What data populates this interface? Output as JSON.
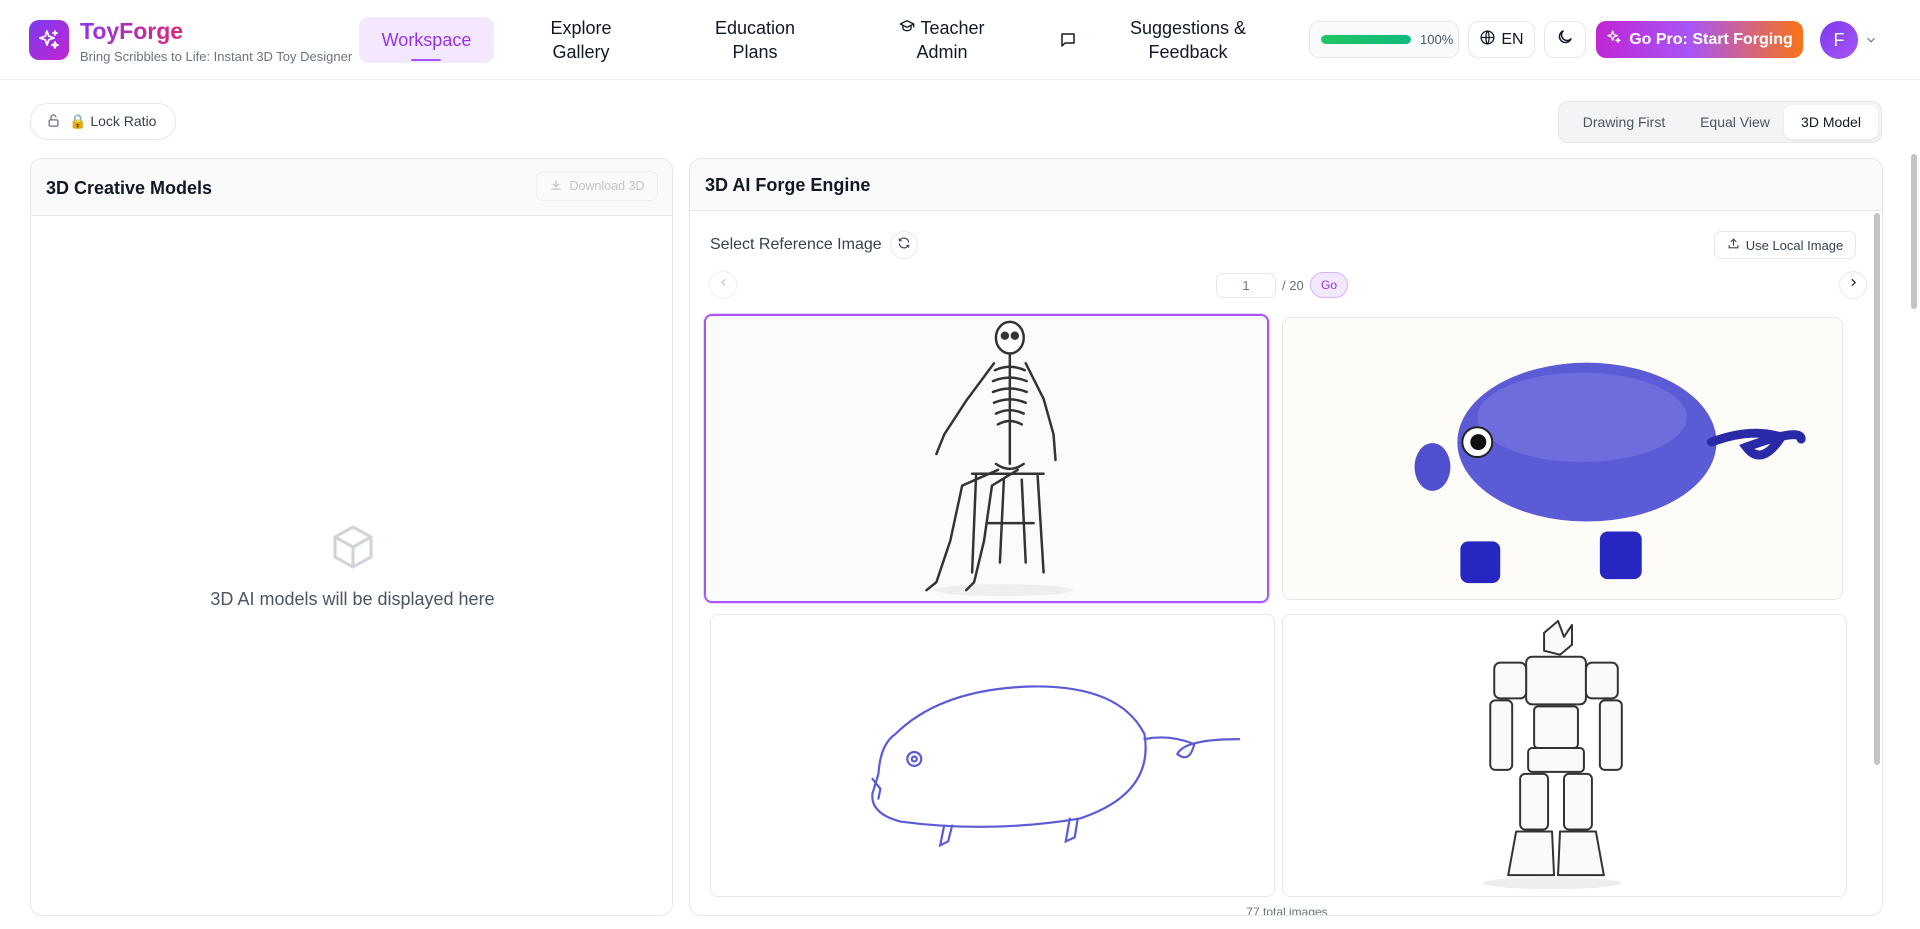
{
  "brand": {
    "name": "ToyForge",
    "tagline": "Bring Scribbles to Life: Instant 3D Toy Designer",
    "accent": "#9333ea"
  },
  "nav": {
    "workspace": "Workspace",
    "explore": [
      "Explore",
      "Gallery"
    ],
    "education": [
      "Education",
      "Plans"
    ],
    "teacher": [
      "Teacher",
      "Admin"
    ],
    "feedback_icon": "message-square-icon",
    "suggestions": [
      "Suggestions &",
      "Feedback"
    ]
  },
  "header": {
    "progress_value": 1.0,
    "progress_label": "100%",
    "language": "EN",
    "pro_button": "Go Pro: Start Forging",
    "avatar_initial": "F"
  },
  "toolbar": {
    "lock_ratio": "🔒 Lock Ratio",
    "view_options": [
      "Drawing First",
      "Equal View",
      "3D Model"
    ],
    "active_view": "3D Model"
  },
  "left_panel": {
    "title": "3D Creative Models",
    "download_label": "Download 3D",
    "empty_icon": "cube-icon",
    "empty_text": "3D AI models will be displayed here"
  },
  "right_panel": {
    "title": "3D AI Forge Engine",
    "reference_label": "Select Reference Image",
    "local_image_label": "Use Local Image",
    "page_value": "1",
    "page_total": "/ 20",
    "go_label": "Go",
    "total_images": "77 total images",
    "images": [
      {
        "name": "skeleton-sitting-on-stool",
        "selected": true
      },
      {
        "name": "blue-3d-pig-toy",
        "selected": false
      },
      {
        "name": "blue-pig-line-drawing",
        "selected": false
      },
      {
        "name": "robot-mecha-line-drawing",
        "selected": false
      }
    ]
  }
}
